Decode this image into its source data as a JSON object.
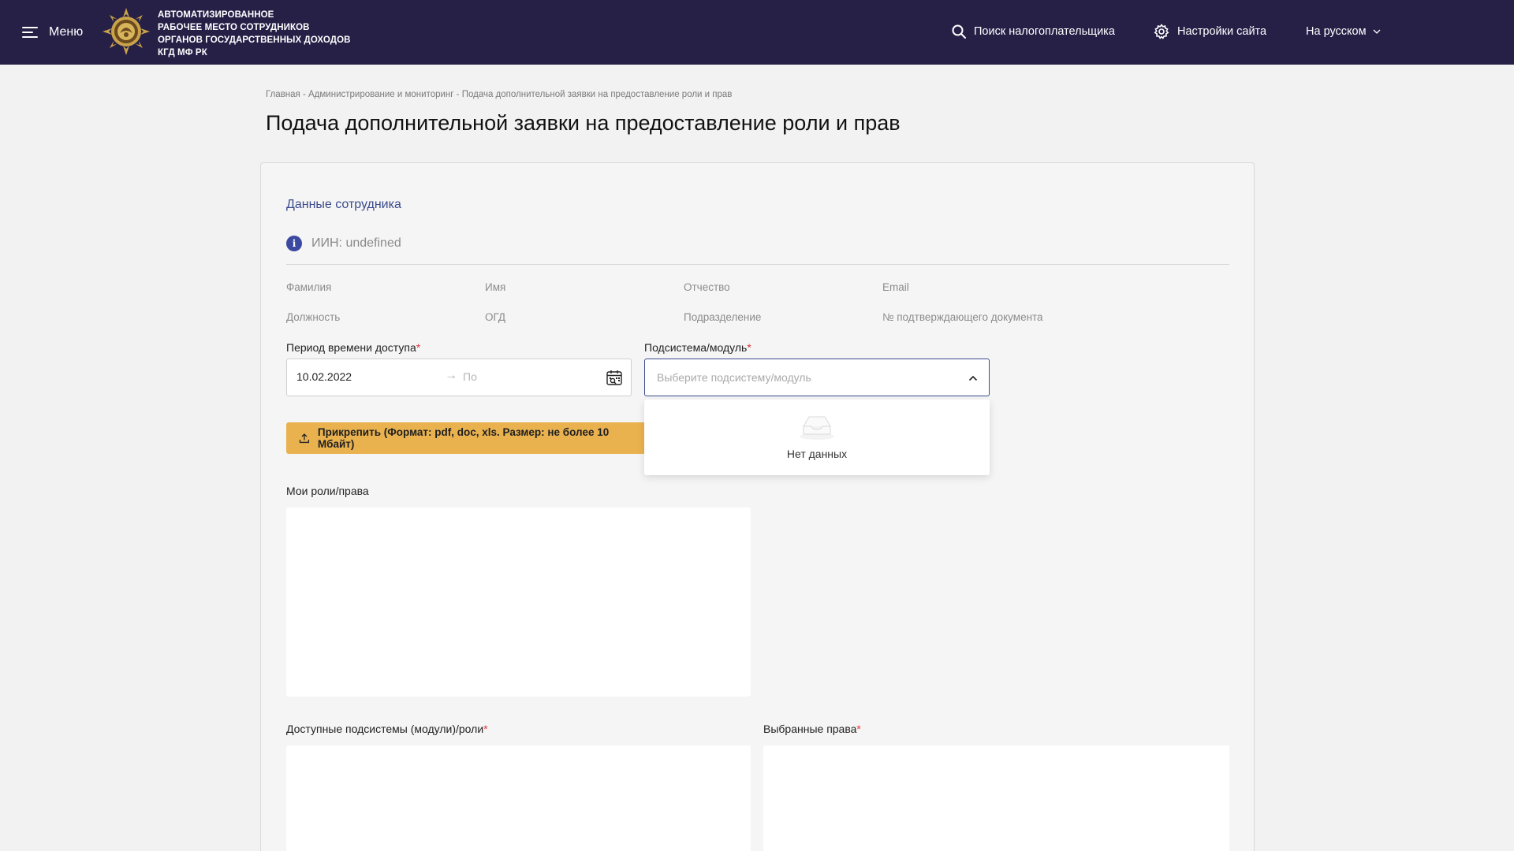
{
  "header": {
    "menu_label": "Меню",
    "brand_line1": "АВТОМАТИЗИРОВАННОЕ",
    "brand_line2": "РАБОЧЕЕ МЕСТО СОТРУДНИКОВ",
    "brand_line3": "ОРГАНОВ ГОСУДАРСТВЕННЫХ ДОХОДОВ",
    "brand_line4": "КГД МФ РК",
    "search_label": "Поиск налогоплательщика",
    "settings_label": "Настройки сайта",
    "language_label": "На русском",
    "icons": [
      "menu-icon",
      "emblem-logo",
      "search-icon",
      "gear-icon",
      "chevron-down-icon"
    ]
  },
  "breadcrumb": {
    "items": [
      "Главная",
      "Администрирование и мониторинг",
      "Подача дополнительной заявки на предоставление роли и прав"
    ],
    "separator": " - "
  },
  "page_title": "Подача дополнительной заявки на предоставление роли и прав",
  "employee": {
    "section_title": "Данные сотрудника",
    "iin_text": "ИИН: undefined",
    "fields": {
      "last_name": "Фамилия",
      "first_name": "Имя",
      "patronymic": "Отчество",
      "email": "Email",
      "position": "Должность",
      "ogd": "ОГД",
      "department": "Подразделение",
      "doc_number": "№ подтверждающего документа"
    }
  },
  "form": {
    "period_label": "Период времени доступа",
    "period_from": "10.02.2022",
    "period_arrow": "→",
    "period_to_placeholder": "По",
    "subsystem_label": "Подсистема/модуль",
    "subsystem_placeholder": "Выберите подсистему/модуль",
    "dropdown_empty": "Нет данных",
    "required_mark": "*",
    "attach_label": "Прикрепить (Формат: pdf, doc, xls. Размер: не более 10 Мбайт)",
    "my_roles_label": "Мои роли/права",
    "available_label": "Доступные подсистемы (модули)/роли",
    "selected_label": "Выбранные права"
  },
  "colors": {
    "header_bg": "#262047",
    "accent": "#3b4a8c",
    "attach_button": "#e9b24f",
    "required": "#e0383e",
    "page_bg": "#f2f2f2"
  }
}
